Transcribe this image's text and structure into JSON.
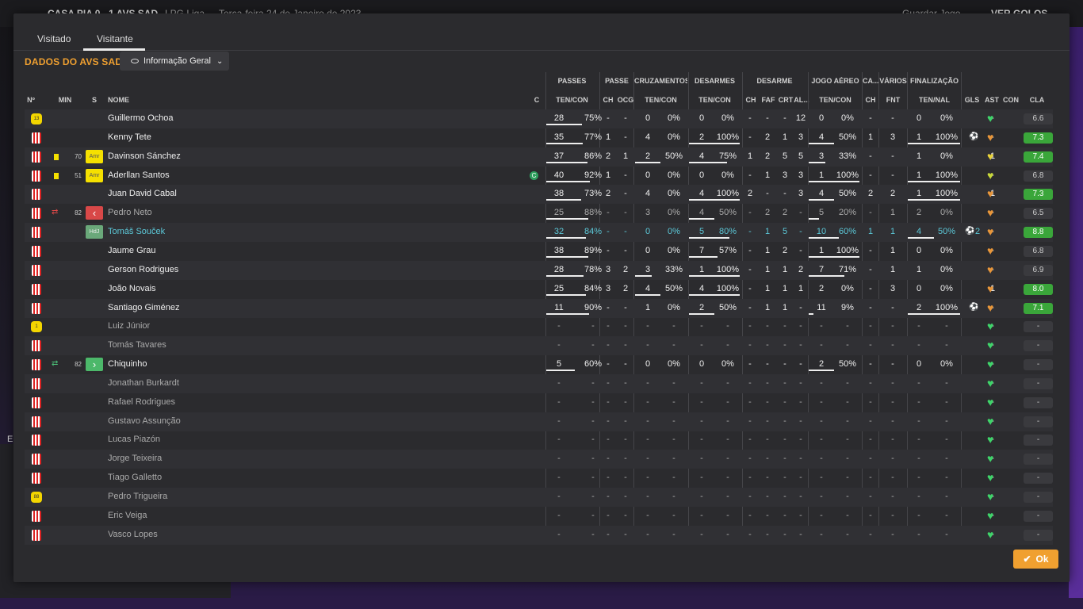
{
  "background": {
    "match_title": "CASA PIA  0 - 1  AVS SAD",
    "competition": "LPG Liga",
    "date": "Terça-feira 24 de Janeiro de 2023",
    "save_label": "Guardar Jogo",
    "goals_label": "VER GOLOS",
    "left_letter": "E"
  },
  "tabs": [
    {
      "label": "Visitado"
    },
    {
      "label": "Visitante"
    }
  ],
  "section_title": "DADOS DO AVS SAD",
  "view_dropdown": {
    "label": "Informação Geral"
  },
  "column_groups": [
    {
      "label": "PASSES"
    },
    {
      "label": "PASSE"
    },
    {
      "label": "CRUZAMENTOS"
    },
    {
      "label": "DESARMES"
    },
    {
      "label": "DESARME"
    },
    {
      "label": "JOGO AÉREO"
    },
    {
      "label": "CA..."
    },
    {
      "label": "VÁRIOS"
    },
    {
      "label": "FINALIZAÇÃO"
    }
  ],
  "columns": {
    "n": "Nº",
    "min": "MIN",
    "s": "S",
    "name": "NOME",
    "c": "C",
    "passes": "TEN/CON",
    "passe_ch": "CH",
    "passe_ocg": "OCG",
    "cruz": "TEN/CON",
    "desarmes": "TEN/CON",
    "des_ch": "CH",
    "des_faf": "FAF",
    "des_crt": "CRT",
    "des_al": "AL...",
    "aereo": "TEN/CON",
    "ca_ch": "CH",
    "fnt": "FNT",
    "final": "TEN/NAL",
    "gls": "GLS",
    "ast": "AST",
    "con": "CON",
    "cla": "CLA"
  },
  "players": [
    {
      "kit": "gk",
      "kit_label": "13",
      "card": false,
      "sub": "",
      "min": "",
      "pos": "",
      "name": "Guillermo Ochoa",
      "style": "",
      "cap": false,
      "p_a": "28",
      "p_b": "75%",
      "p_bar": 0.75,
      "pc": "-",
      "po": "-",
      "c_a": "0",
      "c_b": "0%",
      "c_bar": 0,
      "d_a": "0",
      "d_b": "0%",
      "d_bar": 0,
      "dch": "-",
      "faf": "-",
      "crt": "-",
      "al": "12",
      "a_a": "0",
      "a_b": "0%",
      "a_bar": 0,
      "ach": "-",
      "fnt": "-",
      "f_a": "0",
      "f_b": "0%",
      "f_bar": 0,
      "gls": "",
      "gls_num": "",
      "ast": "-",
      "con": "#3fd46a",
      "rating": "6.6",
      "rating_green": false
    },
    {
      "kit": "shirt",
      "kit_label": "",
      "card": false,
      "sub": "",
      "min": "",
      "pos": "",
      "name": "Kenny Tete",
      "style": "",
      "cap": false,
      "p_a": "35",
      "p_b": "77%",
      "p_bar": 0.77,
      "pc": "1",
      "po": "-",
      "c_a": "4",
      "c_b": "0%",
      "c_bar": 0,
      "d_a": "2",
      "d_b": "100%",
      "d_bar": 1,
      "dch": "-",
      "faf": "2",
      "crt": "1",
      "al": "3",
      "a_a": "4",
      "a_b": "50%",
      "a_bar": 0.5,
      "ach": "1",
      "fnt": "3",
      "f_a": "1",
      "f_b": "100%",
      "f_bar": 1,
      "gls": "ball",
      "gls_num": "",
      "ast": "-",
      "con": "#e8963a",
      "rating": "7.3",
      "rating_green": true
    },
    {
      "kit": "shirt",
      "kit_label": "",
      "card": true,
      "sub": "",
      "min": "70",
      "pos": "Amr",
      "name": "Davinson Sánchez",
      "style": "",
      "cap": false,
      "p_a": "37",
      "p_b": "86%",
      "p_bar": 0.86,
      "pc": "2",
      "po": "1",
      "c_a": "2",
      "c_b": "50%",
      "c_bar": 0.5,
      "d_a": "4",
      "d_b": "75%",
      "d_bar": 0.75,
      "dch": "1",
      "faf": "2",
      "crt": "5",
      "al": "5",
      "a_a": "3",
      "a_b": "33%",
      "a_bar": 0.33,
      "ach": "-",
      "fnt": "-",
      "f_a": "1",
      "f_b": "0%",
      "f_bar": 0,
      "gls": "",
      "gls_num": "",
      "ast": "1",
      "con": "#e8d23a",
      "rating": "7.4",
      "rating_green": true
    },
    {
      "kit": "shirt",
      "kit_label": "",
      "card": true,
      "sub": "",
      "min": "51",
      "pos": "Amr",
      "name": "Aderllan Santos",
      "style": "",
      "cap": true,
      "cap_label": "C",
      "p_a": "40",
      "p_b": "92%",
      "p_bar": 0.92,
      "pc": "1",
      "po": "-",
      "c_a": "0",
      "c_b": "0%",
      "c_bar": 0,
      "d_a": "0",
      "d_b": "0%",
      "d_bar": 0,
      "dch": "-",
      "faf": "1",
      "crt": "3",
      "al": "3",
      "a_a": "1",
      "a_b": "100%",
      "a_bar": 1,
      "ach": "-",
      "fnt": "-",
      "f_a": "1",
      "f_b": "100%",
      "f_bar": 1,
      "gls": "",
      "gls_num": "",
      "ast": "-",
      "con": "#c8d83a",
      "rating": "6.8",
      "rating_green": false
    },
    {
      "kit": "shirt",
      "kit_label": "",
      "card": false,
      "sub": "",
      "min": "",
      "pos": "",
      "name": "Juan David Cabal",
      "style": "",
      "cap": false,
      "p_a": "38",
      "p_b": "73%",
      "p_bar": 0.73,
      "pc": "2",
      "po": "-",
      "c_a": "4",
      "c_b": "0%",
      "c_bar": 0,
      "d_a": "4",
      "d_b": "100%",
      "d_bar": 1,
      "dch": "2",
      "faf": "-",
      "crt": "-",
      "al": "3",
      "a_a": "4",
      "a_b": "50%",
      "a_bar": 0.5,
      "ach": "2",
      "fnt": "2",
      "f_a": "1",
      "f_b": "100%",
      "f_bar": 1,
      "gls": "",
      "gls_num": "",
      "ast": "1",
      "con": "#e8963a",
      "rating": "7.3",
      "rating_green": true
    },
    {
      "kit": "shirt",
      "kit_label": "",
      "card": false,
      "sub": "out",
      "min": "82",
      "pos": "out",
      "name": "Pedro Neto",
      "style": "dim",
      "cap": false,
      "p_a": "25",
      "p_b": "88%",
      "p_bar": 0.88,
      "pc": "-",
      "po": "-",
      "c_a": "3",
      "c_b": "0%",
      "c_bar": 0,
      "d_a": "4",
      "d_b": "50%",
      "d_bar": 0.5,
      "dch": "-",
      "faf": "2",
      "crt": "2",
      "al": "-",
      "a_a": "5",
      "a_b": "20%",
      "a_bar": 0.2,
      "ach": "-",
      "fnt": "1",
      "f_a": "2",
      "f_b": "0%",
      "f_bar": 0,
      "gls": "",
      "gls_num": "",
      "ast": "-",
      "con": "#e8963a",
      "rating": "6.5",
      "rating_green": false
    },
    {
      "kit": "shirt",
      "kit_label": "",
      "card": false,
      "sub": "",
      "min": "",
      "pos": "HdJ",
      "name": "Tomáš Souček",
      "style": "teal",
      "cap": false,
      "p_a": "32",
      "p_b": "84%",
      "p_bar": 0.84,
      "pc": "-",
      "po": "-",
      "c_a": "0",
      "c_b": "0%",
      "c_bar": 0,
      "d_a": "5",
      "d_b": "80%",
      "d_bar": 0.8,
      "dch": "-",
      "faf": "1",
      "crt": "5",
      "al": "-",
      "a_a": "10",
      "a_b": "60%",
      "a_bar": 0.6,
      "ach": "1",
      "fnt": "1",
      "f_a": "4",
      "f_b": "50%",
      "f_bar": 0.5,
      "gls": "ball",
      "gls_num": "2",
      "ast": "-",
      "con": "#e8963a",
      "rating": "8.8",
      "rating_green": true
    },
    {
      "kit": "shirt",
      "kit_label": "",
      "card": false,
      "sub": "",
      "min": "",
      "pos": "",
      "name": "Jaume Grau",
      "style": "",
      "cap": false,
      "p_a": "38",
      "p_b": "89%",
      "p_bar": 0.89,
      "pc": "-",
      "po": "-",
      "c_a": "0",
      "c_b": "0%",
      "c_bar": 0,
      "d_a": "7",
      "d_b": "57%",
      "d_bar": 0.57,
      "dch": "-",
      "faf": "1",
      "crt": "2",
      "al": "-",
      "a_a": "1",
      "a_b": "100%",
      "a_bar": 1,
      "ach": "-",
      "fnt": "1",
      "f_a": "0",
      "f_b": "0%",
      "f_bar": 0,
      "gls": "",
      "gls_num": "",
      "ast": "-",
      "con": "#e8963a",
      "rating": "6.8",
      "rating_green": false
    },
    {
      "kit": "shirt",
      "kit_label": "",
      "card": false,
      "sub": "",
      "min": "",
      "pos": "",
      "name": "Gerson Rodrigues",
      "style": "",
      "cap": false,
      "p_a": "28",
      "p_b": "78%",
      "p_bar": 0.78,
      "pc": "3",
      "po": "2",
      "c_a": "3",
      "c_b": "33%",
      "c_bar": 0.33,
      "d_a": "1",
      "d_b": "100%",
      "d_bar": 1,
      "dch": "-",
      "faf": "1",
      "crt": "1",
      "al": "2",
      "a_a": "7",
      "a_b": "71%",
      "a_bar": 0.71,
      "ach": "-",
      "fnt": "1",
      "f_a": "1",
      "f_b": "0%",
      "f_bar": 0,
      "gls": "",
      "gls_num": "",
      "ast": "-",
      "con": "#e8963a",
      "rating": "6.9",
      "rating_green": false
    },
    {
      "kit": "shirt",
      "kit_label": "",
      "card": false,
      "sub": "",
      "min": "",
      "pos": "",
      "name": "João Novais",
      "style": "",
      "cap": false,
      "p_a": "25",
      "p_b": "84%",
      "p_bar": 0.84,
      "pc": "3",
      "po": "2",
      "c_a": "4",
      "c_b": "50%",
      "c_bar": 0.5,
      "d_a": "4",
      "d_b": "100%",
      "d_bar": 1,
      "dch": "-",
      "faf": "1",
      "crt": "1",
      "al": "1",
      "a_a": "2",
      "a_b": "0%",
      "a_bar": 0,
      "ach": "-",
      "fnt": "3",
      "f_a": "0",
      "f_b": "0%",
      "f_bar": 0,
      "gls": "",
      "gls_num": "",
      "ast": "1",
      "con": "#e8963a",
      "rating": "8.0",
      "rating_green": true
    },
    {
      "kit": "shirt",
      "kit_label": "",
      "card": false,
      "sub": "",
      "min": "",
      "pos": "",
      "name": "Santiago Giménez",
      "style": "",
      "cap": false,
      "p_a": "11",
      "p_b": "90%",
      "p_bar": 0.9,
      "pc": "-",
      "po": "-",
      "c_a": "1",
      "c_b": "0%",
      "c_bar": 0,
      "d_a": "2",
      "d_b": "50%",
      "d_bar": 0.5,
      "dch": "-",
      "faf": "1",
      "crt": "1",
      "al": "-",
      "a_a": "11",
      "a_b": "9%",
      "a_bar": 0.09,
      "ach": "-",
      "fnt": "-",
      "f_a": "2",
      "f_b": "100%",
      "f_bar": 1,
      "gls": "ball",
      "gls_num": "",
      "ast": "-",
      "con": "#e8963a",
      "rating": "7.1",
      "rating_green": true
    },
    {
      "kit": "gk",
      "kit_label": "1",
      "card": false,
      "sub": "",
      "min": "",
      "pos": "",
      "name": "Luiz Júnior",
      "style": "dim",
      "cap": false,
      "p_a": "-",
      "p_b": "-",
      "p_bar": 0,
      "pc": "-",
      "po": "-",
      "c_a": "-",
      "c_b": "-",
      "c_bar": 0,
      "d_a": "-",
      "d_b": "-",
      "d_bar": 0,
      "dch": "-",
      "faf": "-",
      "crt": "-",
      "al": "-",
      "a_a": "-",
      "a_b": "-",
      "a_bar": 0,
      "ach": "-",
      "fnt": "-",
      "f_a": "-",
      "f_b": "-",
      "f_bar": 0,
      "gls": "",
      "gls_num": "",
      "ast": "-",
      "con": "#3fd46a",
      "rating": "-",
      "rating_green": false
    },
    {
      "kit": "shirt",
      "kit_label": "",
      "card": false,
      "sub": "",
      "min": "",
      "pos": "",
      "name": "Tomás Tavares",
      "style": "dim",
      "cap": false,
      "p_a": "-",
      "p_b": "-",
      "p_bar": 0,
      "pc": "-",
      "po": "-",
      "c_a": "-",
      "c_b": "-",
      "c_bar": 0,
      "d_a": "-",
      "d_b": "-",
      "d_bar": 0,
      "dch": "-",
      "faf": "-",
      "crt": "-",
      "al": "-",
      "a_a": "-",
      "a_b": "-",
      "a_bar": 0,
      "ach": "-",
      "fnt": "-",
      "f_a": "-",
      "f_b": "-",
      "f_bar": 0,
      "gls": "",
      "gls_num": "",
      "ast": "-",
      "con": "#3fd46a",
      "rating": "-",
      "rating_green": false
    },
    {
      "kit": "shirt",
      "kit_label": "",
      "card": false,
      "sub": "in",
      "min": "82",
      "pos": "in",
      "name": "Chiquinho",
      "style": "",
      "cap": false,
      "p_a": "5",
      "p_b": "60%",
      "p_bar": 0.6,
      "pc": "-",
      "po": "-",
      "c_a": "0",
      "c_b": "0%",
      "c_bar": 0,
      "d_a": "0",
      "d_b": "0%",
      "d_bar": 0,
      "dch": "-",
      "faf": "-",
      "crt": "-",
      "al": "-",
      "a_a": "2",
      "a_b": "50%",
      "a_bar": 0.5,
      "ach": "-",
      "fnt": "-",
      "f_a": "0",
      "f_b": "0%",
      "f_bar": 0,
      "gls": "",
      "gls_num": "",
      "ast": "-",
      "con": "#3fd46a",
      "rating": "-",
      "rating_green": false
    },
    {
      "kit": "shirt",
      "kit_label": "",
      "card": false,
      "sub": "",
      "min": "",
      "pos": "",
      "name": "Jonathan Burkardt",
      "style": "dim",
      "cap": false,
      "p_a": "-",
      "p_b": "-",
      "p_bar": 0,
      "pc": "-",
      "po": "-",
      "c_a": "-",
      "c_b": "-",
      "c_bar": 0,
      "d_a": "-",
      "d_b": "-",
      "d_bar": 0,
      "dch": "-",
      "faf": "-",
      "crt": "-",
      "al": "-",
      "a_a": "-",
      "a_b": "-",
      "a_bar": 0,
      "ach": "-",
      "fnt": "-",
      "f_a": "-",
      "f_b": "-",
      "f_bar": 0,
      "gls": "",
      "gls_num": "",
      "ast": "-",
      "con": "#3fd46a",
      "rating": "-",
      "rating_green": false
    },
    {
      "kit": "shirt",
      "kit_label": "",
      "card": false,
      "sub": "",
      "min": "",
      "pos": "",
      "name": "Rafael Rodrigues",
      "style": "dim",
      "cap": false,
      "p_a": "-",
      "p_b": "-",
      "p_bar": 0,
      "pc": "-",
      "po": "-",
      "c_a": "-",
      "c_b": "-",
      "c_bar": 0,
      "d_a": "-",
      "d_b": "-",
      "d_bar": 0,
      "dch": "-",
      "faf": "-",
      "crt": "-",
      "al": "-",
      "a_a": "-",
      "a_b": "-",
      "a_bar": 0,
      "ach": "-",
      "fnt": "-",
      "f_a": "-",
      "f_b": "-",
      "f_bar": 0,
      "gls": "",
      "gls_num": "",
      "ast": "-",
      "con": "#3fd46a",
      "rating": "-",
      "rating_green": false
    },
    {
      "kit": "shirt",
      "kit_label": "",
      "card": false,
      "sub": "",
      "min": "",
      "pos": "",
      "name": "Gustavo Assunção",
      "style": "dim",
      "cap": false,
      "p_a": "-",
      "p_b": "-",
      "p_bar": 0,
      "pc": "-",
      "po": "-",
      "c_a": "-",
      "c_b": "-",
      "c_bar": 0,
      "d_a": "-",
      "d_b": "-",
      "d_bar": 0,
      "dch": "-",
      "faf": "-",
      "crt": "-",
      "al": "-",
      "a_a": "-",
      "a_b": "-",
      "a_bar": 0,
      "ach": "-",
      "fnt": "-",
      "f_a": "-",
      "f_b": "-",
      "f_bar": 0,
      "gls": "",
      "gls_num": "",
      "ast": "-",
      "con": "#3fd46a",
      "rating": "-",
      "rating_green": false
    },
    {
      "kit": "shirt",
      "kit_label": "",
      "card": false,
      "sub": "",
      "min": "",
      "pos": "",
      "name": "Lucas Piazón",
      "style": "dim",
      "cap": false,
      "p_a": "-",
      "p_b": "-",
      "p_bar": 0,
      "pc": "-",
      "po": "-",
      "c_a": "-",
      "c_b": "-",
      "c_bar": 0,
      "d_a": "-",
      "d_b": "-",
      "d_bar": 0,
      "dch": "-",
      "faf": "-",
      "crt": "-",
      "al": "-",
      "a_a": "-",
      "a_b": "-",
      "a_bar": 0,
      "ach": "-",
      "fnt": "-",
      "f_a": "-",
      "f_b": "-",
      "f_bar": 0,
      "gls": "",
      "gls_num": "",
      "ast": "-",
      "con": "#3fd46a",
      "rating": "-",
      "rating_green": false
    },
    {
      "kit": "shirt",
      "kit_label": "",
      "card": false,
      "sub": "",
      "min": "",
      "pos": "",
      "name": "Jorge Teixeira",
      "style": "dim",
      "cap": false,
      "p_a": "-",
      "p_b": "-",
      "p_bar": 0,
      "pc": "-",
      "po": "-",
      "c_a": "-",
      "c_b": "-",
      "c_bar": 0,
      "d_a": "-",
      "d_b": "-",
      "d_bar": 0,
      "dch": "-",
      "faf": "-",
      "crt": "-",
      "al": "-",
      "a_a": "-",
      "a_b": "-",
      "a_bar": 0,
      "ach": "-",
      "fnt": "-",
      "f_a": "-",
      "f_b": "-",
      "f_bar": 0,
      "gls": "",
      "gls_num": "",
      "ast": "-",
      "con": "#3fd46a",
      "rating": "-",
      "rating_green": false
    },
    {
      "kit": "shirt",
      "kit_label": "",
      "card": false,
      "sub": "",
      "min": "",
      "pos": "",
      "name": "Tiago Galletto",
      "style": "dim",
      "cap": false,
      "p_a": "-",
      "p_b": "-",
      "p_bar": 0,
      "pc": "-",
      "po": "-",
      "c_a": "-",
      "c_b": "-",
      "c_bar": 0,
      "d_a": "-",
      "d_b": "-",
      "d_bar": 0,
      "dch": "-",
      "faf": "-",
      "crt": "-",
      "al": "-",
      "a_a": "-",
      "a_b": "-",
      "a_bar": 0,
      "ach": "-",
      "fnt": "-",
      "f_a": "-",
      "f_b": "-",
      "f_bar": 0,
      "gls": "",
      "gls_num": "",
      "ast": "-",
      "con": "#3fd46a",
      "rating": "-",
      "rating_green": false
    },
    {
      "kit": "gk",
      "kit_label": "88",
      "card": false,
      "sub": "",
      "min": "",
      "pos": "",
      "name": "Pedro Trigueira",
      "style": "dim",
      "cap": false,
      "p_a": "-",
      "p_b": "-",
      "p_bar": 0,
      "pc": "-",
      "po": "-",
      "c_a": "-",
      "c_b": "-",
      "c_bar": 0,
      "d_a": "-",
      "d_b": "-",
      "d_bar": 0,
      "dch": "-",
      "faf": "-",
      "crt": "-",
      "al": "-",
      "a_a": "-",
      "a_b": "-",
      "a_bar": 0,
      "ach": "-",
      "fnt": "-",
      "f_a": "-",
      "f_b": "-",
      "f_bar": 0,
      "gls": "",
      "gls_num": "",
      "ast": "-",
      "con": "#3fd46a",
      "rating": "-",
      "rating_green": false
    },
    {
      "kit": "shirt",
      "kit_label": "",
      "card": false,
      "sub": "",
      "min": "",
      "pos": "",
      "name": "Eric Veiga",
      "style": "dim",
      "cap": false,
      "p_a": "-",
      "p_b": "-",
      "p_bar": 0,
      "pc": "-",
      "po": "-",
      "c_a": "-",
      "c_b": "-",
      "c_bar": 0,
      "d_a": "-",
      "d_b": "-",
      "d_bar": 0,
      "dch": "-",
      "faf": "-",
      "crt": "-",
      "al": "-",
      "a_a": "-",
      "a_b": "-",
      "a_bar": 0,
      "ach": "-",
      "fnt": "-",
      "f_a": "-",
      "f_b": "-",
      "f_bar": 0,
      "gls": "",
      "gls_num": "",
      "ast": "-",
      "con": "#3fd46a",
      "rating": "-",
      "rating_green": false
    },
    {
      "kit": "shirt",
      "kit_label": "",
      "card": false,
      "sub": "",
      "min": "",
      "pos": "",
      "name": "Vasco Lopes",
      "style": "dim",
      "cap": false,
      "p_a": "-",
      "p_b": "-",
      "p_bar": 0,
      "pc": "-",
      "po": "-",
      "c_a": "-",
      "c_b": "-",
      "c_bar": 0,
      "d_a": "-",
      "d_b": "-",
      "d_bar": 0,
      "dch": "-",
      "faf": "-",
      "crt": "-",
      "al": "-",
      "a_a": "-",
      "a_b": "-",
      "a_bar": 0,
      "ach": "-",
      "fnt": "-",
      "f_a": "-",
      "f_b": "-",
      "f_bar": 0,
      "gls": "",
      "gls_num": "",
      "ast": "-",
      "con": "#3fd46a",
      "rating": "-",
      "rating_green": false
    }
  ],
  "ok_label": "Ok"
}
